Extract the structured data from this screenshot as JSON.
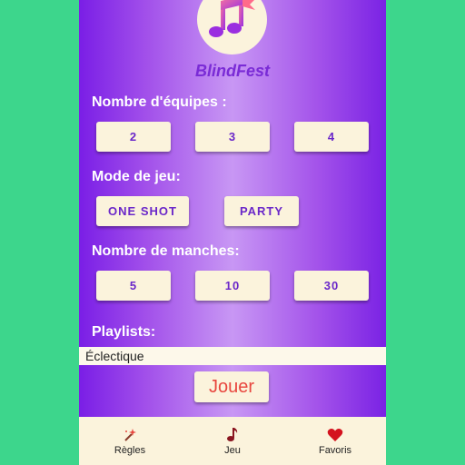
{
  "app": {
    "title": "BlindFest"
  },
  "sections": {
    "teams": {
      "label": "Nombre d'équipes :",
      "options": [
        "2",
        "3",
        "4"
      ]
    },
    "mode": {
      "label": "Mode de jeu:",
      "options": [
        "ONE SHOT",
        "PARTY"
      ]
    },
    "rounds": {
      "label": "Nombre de manches:",
      "options": [
        "5",
        "10",
        "30"
      ]
    },
    "playlists": {
      "label": "Playlists:",
      "selected": "Éclectique"
    }
  },
  "play_button": {
    "label": "Jouer"
  },
  "bottom_nav": {
    "items": [
      {
        "label": "Règles",
        "icon": "magic-wand-icon"
      },
      {
        "label": "Jeu",
        "icon": "music-note-icon"
      },
      {
        "label": "Favoris",
        "icon": "heart-icon"
      }
    ]
  },
  "colors": {
    "background": "#3dd68c",
    "accent": "#7a1ee6",
    "button_bg": "#fbf3dc",
    "button_text": "#6a27c9",
    "play_text": "#e8463e"
  }
}
